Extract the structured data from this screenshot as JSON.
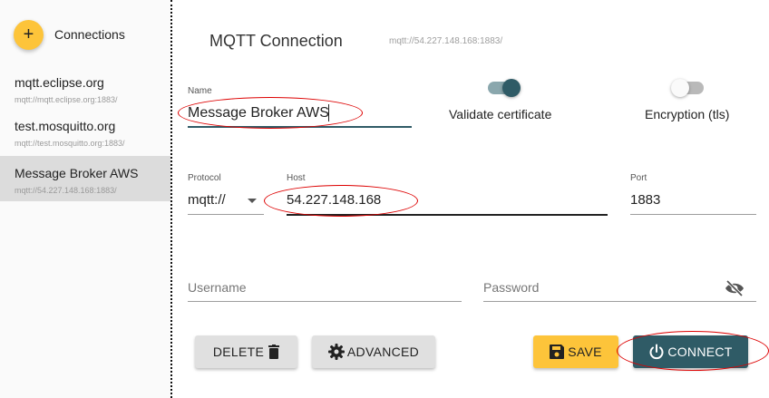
{
  "sidebar": {
    "add_icon": "+",
    "title": "Connections",
    "items": [
      {
        "name": "mqtt.eclipse.org",
        "url": "mqtt://mqtt.eclipse.org:1883/"
      },
      {
        "name": "test.mosquitto.org",
        "url": "mqtt://test.mosquitto.org:1883/"
      },
      {
        "name": "Message Broker AWS",
        "url": "mqtt://54.227.148.168:1883/"
      }
    ]
  },
  "header": {
    "title": "MQTT Connection",
    "subtitle": "mqtt://54.227.148.168:1883/"
  },
  "form": {
    "name_label": "Name",
    "name_value": "Message Broker AWS",
    "validate_label": "Validate certificate",
    "validate_on": true,
    "tls_label": "Encryption (tls)",
    "tls_on": false,
    "protocol_label": "Protocol",
    "protocol_value": "mqtt://",
    "host_label": "Host",
    "host_value": "54.227.148.168",
    "port_label": "Port",
    "port_value": "1883",
    "username_placeholder": "Username",
    "password_placeholder": "Password"
  },
  "buttons": {
    "delete": "DELETE",
    "advanced": "ADVANCED",
    "save": "SAVE",
    "connect": "CONNECT"
  },
  "colors": {
    "accent": "#fdc43a",
    "primary": "#2f5b66",
    "annotation": "#dd0000"
  }
}
